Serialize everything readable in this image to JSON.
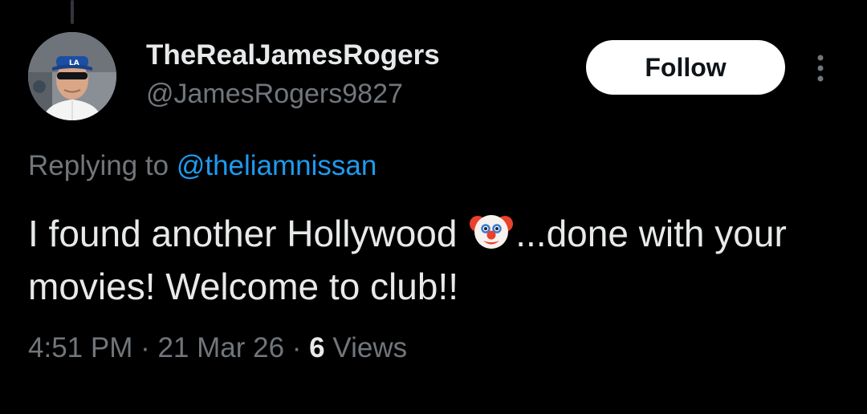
{
  "author": {
    "display_name": "TheRealJamesRogers",
    "handle": "@JamesRogers9827"
  },
  "follow_label": "Follow",
  "reply": {
    "prefix": "Replying to ",
    "mention": "@theliamnissan"
  },
  "tweet": {
    "text_before": "I found another Hollywood ",
    "emoji": "clown-face-emoji",
    "text_after": "...done with your movies! Welcome to club!!"
  },
  "meta": {
    "time": "4:51 PM",
    "sep1": " · ",
    "date": "21 Mar 26",
    "sep2": " · ",
    "views_count": "6",
    "views_label": " Views"
  },
  "colors": {
    "background": "#000000",
    "primary_text": "#e7e9ea",
    "secondary_text": "#71767b",
    "link": "#1d9bf0",
    "follow_button_bg": "#ffffff"
  },
  "icons": {
    "more": "more-vertical-icon",
    "avatar": "profile-photo"
  }
}
